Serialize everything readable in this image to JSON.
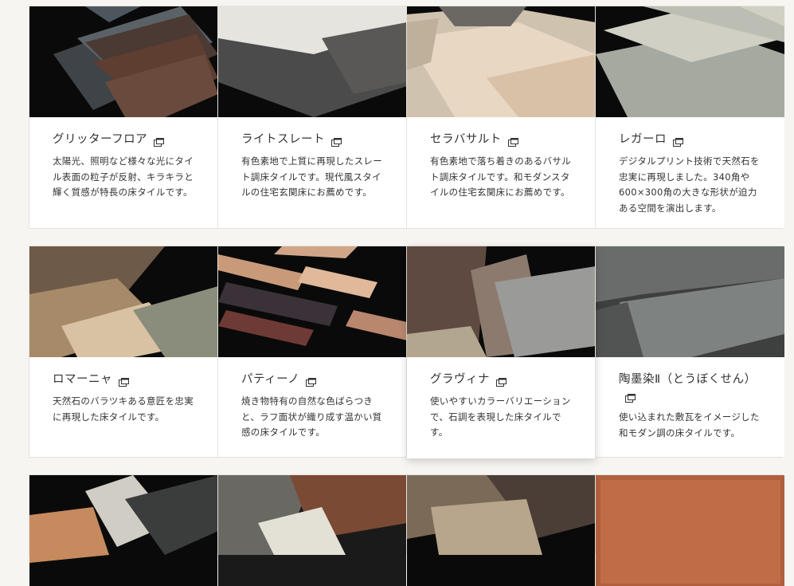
{
  "products": [
    {
      "title": "グリッターフロア",
      "desc": "太陽光、照明など様々な光にタイル表面の粒子が反射、キラキラと輝く質感が特長の床タイルです。"
    },
    {
      "title": "ライトスレート",
      "desc": "有色素地で上質に再現したスレート調床タイルです。現代風スタイルの住宅玄関床にお薦めです。"
    },
    {
      "title": "セラバサルト",
      "desc": "有色素地で落ち着きのあるバサルト調床タイルです。和モダンスタイルの住宅玄関床にお薦めです。"
    },
    {
      "title": "レガーロ",
      "desc": "デジタルプリント技術で天然石を忠実に再現しました。340角や600×300角の大きな形状が迫力ある空間を演出します。"
    },
    {
      "title": "ロマーニャ",
      "desc": "天然石のバラツキある意匠を忠実に再現した床タイルです。"
    },
    {
      "title": "パティーノ",
      "desc": "焼き物特有の自然な色ばらつきと、ラフ面状が織り成す温かい質感の床タイルです。"
    },
    {
      "title": "グラヴィナ",
      "desc": "使いやすいカラーバリエーションで、石調を表現した床タイルです。"
    },
    {
      "title": "陶墨染Ⅱ（とうぼくせん）",
      "desc": "使い込まれた敷瓦をイメージした和モダン調の床タイルです。"
    }
  ],
  "icons": {
    "external": "external-link-icon"
  },
  "colors": {
    "background": "#f6f5f1",
    "card": "#ffffff",
    "border": "#e6e3dc",
    "text": "#333333"
  }
}
